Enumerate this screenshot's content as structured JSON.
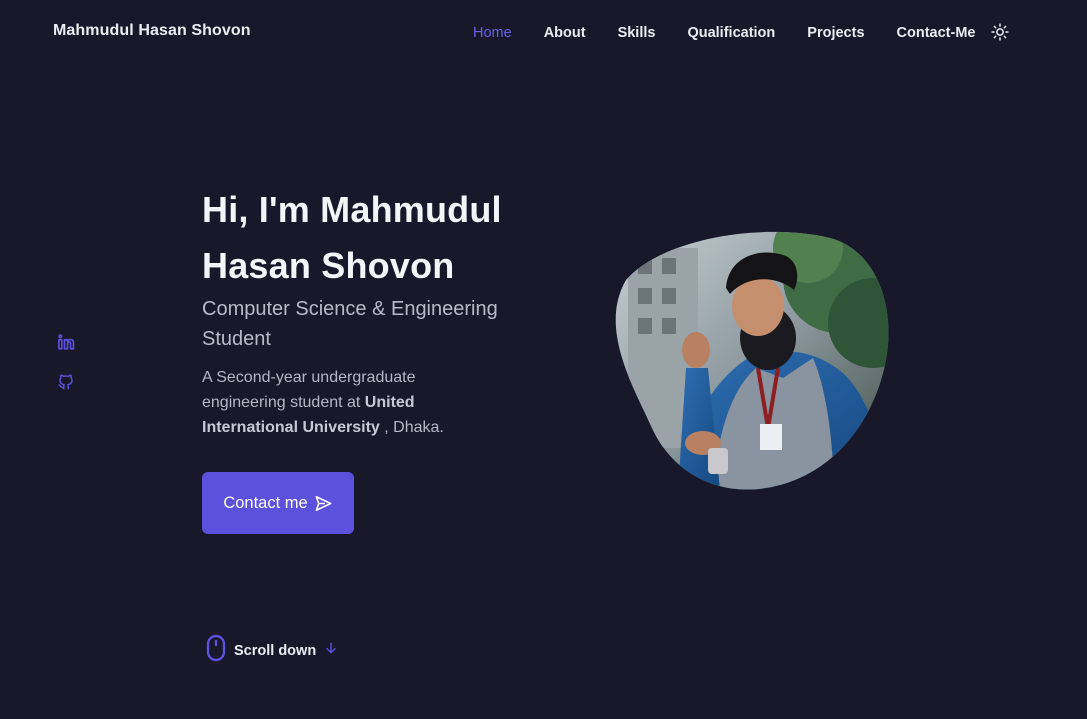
{
  "header": {
    "logo": "Mahmudul Hasan Shovon",
    "nav": [
      {
        "label": "Home",
        "active": true
      },
      {
        "label": "About"
      },
      {
        "label": "Skills"
      },
      {
        "label": "Qualification"
      },
      {
        "label": "Projects"
      },
      {
        "label": "Contact-Me"
      }
    ],
    "theme_icon": "sun-icon"
  },
  "social": [
    {
      "icon": "linkedin-icon"
    },
    {
      "icon": "github-icon"
    }
  ],
  "hero": {
    "title": "Hi, I'm Mahmudul Hasan Shovon",
    "subtitle": "Computer Science & Engineering Student",
    "desc_prefix": "A Second-year undergraduate engineering student at ",
    "desc_university": "United International University",
    "desc_suffix": " , Dhaka.",
    "button_label": "Contact me",
    "button_icon": "send-icon"
  },
  "scroll": {
    "label": "Scroll down",
    "icon": "mouse-icon",
    "arrow_icon": "arrow-down-icon"
  },
  "colors": {
    "background": "#18182a",
    "accent": "#5b51dd",
    "active_nav": "#6b5fe8",
    "text": "#ececf3"
  }
}
